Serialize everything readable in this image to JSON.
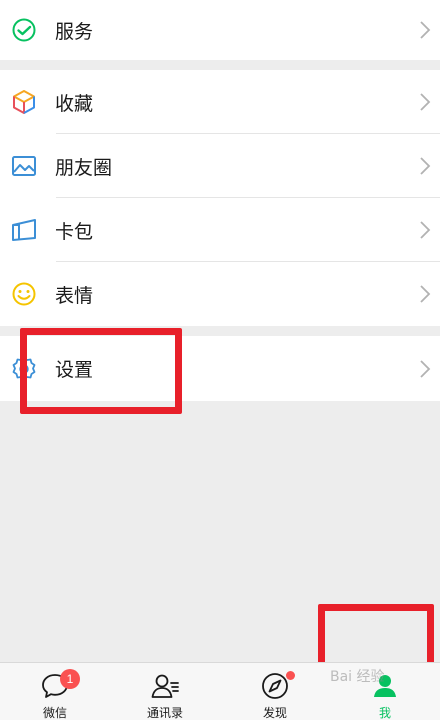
{
  "menu": {
    "service": {
      "label": "服务",
      "icon": "wechat-pay-icon"
    },
    "favorites": {
      "label": "收藏",
      "icon": "cube-icon"
    },
    "moments": {
      "label": "朋友圈",
      "icon": "picture-icon"
    },
    "cards": {
      "label": "卡包",
      "icon": "card-wallet-icon"
    },
    "stickers": {
      "label": "表情",
      "icon": "smiley-icon"
    },
    "settings": {
      "label": "设置",
      "icon": "gear-icon"
    }
  },
  "tabbar": {
    "chats": {
      "label": "微信",
      "badge": "1"
    },
    "contacts": {
      "label": "通讯录"
    },
    "discover": {
      "label": "发现"
    },
    "me": {
      "label": "我"
    }
  },
  "watermark": "Bai 经验",
  "colors": {
    "accent": "#07c160",
    "badge": "#fa5151",
    "annotation": "#e8202a",
    "background": "#ededed"
  }
}
